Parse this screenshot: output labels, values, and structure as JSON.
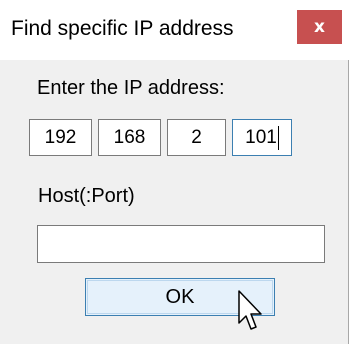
{
  "window": {
    "title": "Find specific IP address",
    "close_glyph": "x"
  },
  "ip": {
    "label": "Enter the IP address:",
    "octets": [
      "192",
      "168",
      "2",
      "101"
    ]
  },
  "host": {
    "label": "Host(:Port)",
    "value": ""
  },
  "buttons": {
    "ok_label": "OK"
  },
  "colors": {
    "close_button_bg": "#c75050",
    "focus_border": "#3c7fb1",
    "dialog_bg": "#f0f0f0"
  },
  "icons": {
    "close": "close-icon",
    "pointer": "mouse-pointer-icon"
  }
}
